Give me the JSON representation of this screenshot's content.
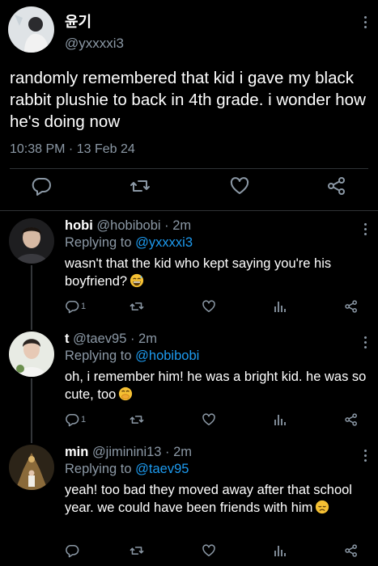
{
  "main_tweet": {
    "display_name": "윤기",
    "handle": "@yxxxxi3",
    "text": "randomly remembered that kid i gave my black rabbit plushie to back in 4th grade. i wonder how he's doing now",
    "timestamp": "10:38 PM · 13 Feb 24",
    "actions": [
      "reply-icon",
      "retweet-icon",
      "like-icon",
      "share-icon"
    ]
  },
  "replies": [
    {
      "name": "hobi",
      "handle": "@hobibobi · 2m",
      "replying_prefix": "Replying to",
      "replying_to": "@yxxxxi3",
      "text": "wasn't that the kid who kept saying you're his boyfriend?",
      "emoji": "sweat-smile-emoji",
      "reply_count": "1"
    },
    {
      "name": "t",
      "handle": "@taev95 · 2m",
      "replying_prefix": "Replying to",
      "replying_to": "@hobibobi",
      "text": "oh, i remember him! he was a bright kid. he was so cute, too",
      "emoji": "hand-over-mouth-emoji",
      "reply_count": "1"
    },
    {
      "name": "min",
      "handle": "@jiminini13 · 2m",
      "replying_prefix": "Replying to",
      "replying_to": "@taev95",
      "text": "yeah! too bad they moved away after that school year. we could have been friends with him",
      "emoji": "disappointed-emoji",
      "reply_count": ""
    }
  ],
  "colors": {
    "background": "#000000",
    "text": "#ffffff",
    "muted": "#8b98a5",
    "link": "#1d9bf0",
    "divider": "#2f3336"
  }
}
